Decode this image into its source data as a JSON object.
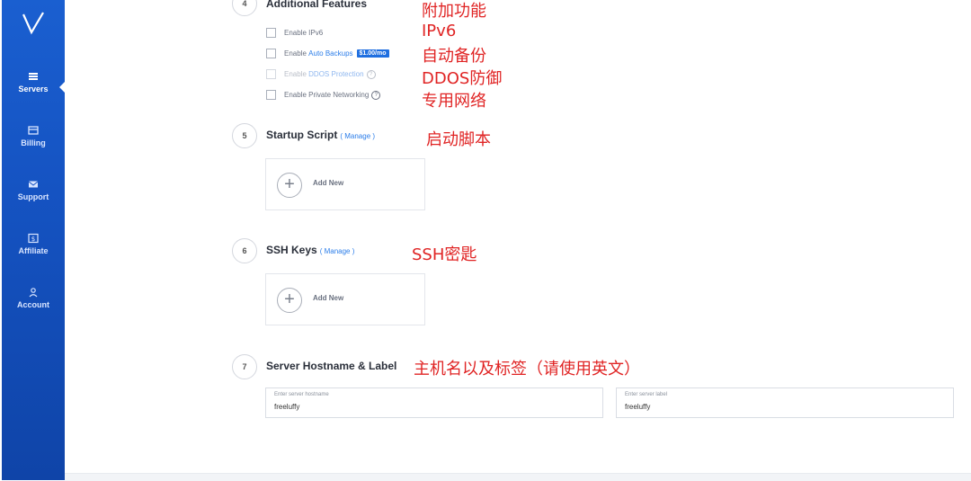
{
  "sidebar": {
    "logo": "V",
    "items": [
      {
        "label": "Servers",
        "icon": "servers-icon",
        "active": true
      },
      {
        "label": "Billing",
        "icon": "billing-icon",
        "active": false
      },
      {
        "label": "Support",
        "icon": "envelope-icon",
        "active": false
      },
      {
        "label": "Affiliate",
        "icon": "dollar-icon",
        "active": false
      },
      {
        "label": "Account",
        "icon": "user-icon",
        "active": false
      }
    ]
  },
  "steps": {
    "additional": {
      "number": "4",
      "title": "Additional Features",
      "options": {
        "ipv6": "Enable IPv6",
        "backups_prefix": "Enable ",
        "backups_link": "Auto Backups",
        "backups_price": "$1.00/mo",
        "ddos_prefix": "Enable ",
        "ddos_link": "DDOS Protection",
        "private_net": "Enable Private Networking"
      }
    },
    "startup": {
      "number": "5",
      "title": "Startup Script",
      "manage": "( Manage )",
      "add_label": "Add New"
    },
    "ssh": {
      "number": "6",
      "title": "SSH Keys",
      "manage": "( Manage )",
      "add_label": "Add New"
    },
    "hostname": {
      "number": "7",
      "title": "Server Hostname & Label",
      "hostname_hint": "Enter server hostname",
      "hostname_value": "freeluffy",
      "label_hint": "Enter server label",
      "label_value": "freeluffy"
    }
  },
  "annotations": {
    "additional": "附加功能",
    "ipv6": "IPv6",
    "backups": "自动备份",
    "ddos": "DDOS防御",
    "private_net": "专用网络",
    "startup": "启动脚本",
    "ssh": "SSH密匙",
    "hostname": "主机名以及标签（请使用英文）"
  },
  "colors": {
    "sidebar": "#1553c2",
    "accent": "#2b7de9",
    "annotation": "#e02424"
  }
}
